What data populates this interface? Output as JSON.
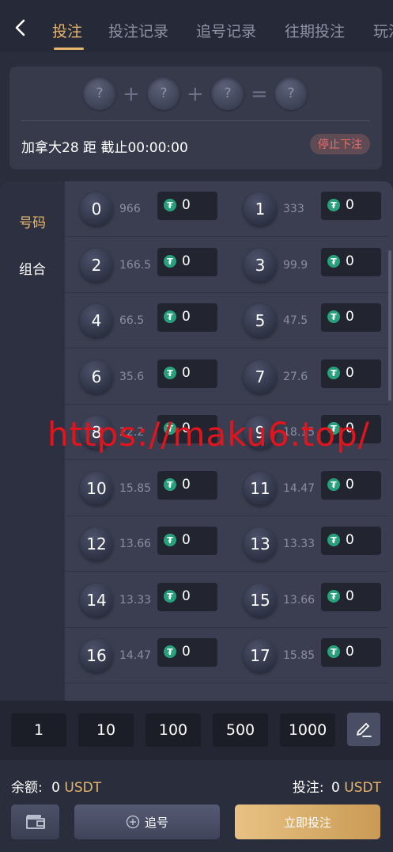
{
  "nav": {
    "tabs": [
      {
        "label": "投注"
      },
      {
        "label": "投注记录"
      },
      {
        "label": "追号记录"
      },
      {
        "label": "往期投注"
      },
      {
        "label": "玩法"
      }
    ]
  },
  "result": {
    "balls": [
      "?",
      "?",
      "?",
      "?"
    ],
    "plus": "+",
    "equals": "=",
    "lottery_info": "加拿大28 距 截止00:00:00",
    "stop_label": "停止下注"
  },
  "sidebar": {
    "items": [
      {
        "label": "号码"
      },
      {
        "label": "组合"
      }
    ]
  },
  "numbers": [
    {
      "num": "0",
      "odds": "966",
      "bet": "0"
    },
    {
      "num": "1",
      "odds": "333",
      "bet": "0"
    },
    {
      "num": "2",
      "odds": "166.5",
      "bet": "0"
    },
    {
      "num": "3",
      "odds": "99.9",
      "bet": "0"
    },
    {
      "num": "4",
      "odds": "66.5",
      "bet": "0"
    },
    {
      "num": "5",
      "odds": "47.5",
      "bet": "0"
    },
    {
      "num": "6",
      "odds": "35.6",
      "bet": "0"
    },
    {
      "num": "7",
      "odds": "27.6",
      "bet": "0"
    },
    {
      "num": "8",
      "odds": "22.2",
      "bet": "0"
    },
    {
      "num": "9",
      "odds": "18.15",
      "bet": "0"
    },
    {
      "num": "10",
      "odds": "15.85",
      "bet": "0"
    },
    {
      "num": "11",
      "odds": "14.47",
      "bet": "0"
    },
    {
      "num": "12",
      "odds": "13.66",
      "bet": "0"
    },
    {
      "num": "13",
      "odds": "13.33",
      "bet": "0"
    },
    {
      "num": "14",
      "odds": "13.33",
      "bet": "0"
    },
    {
      "num": "15",
      "odds": "13.66",
      "bet": "0"
    },
    {
      "num": "16",
      "odds": "14.47",
      "bet": "0"
    },
    {
      "num": "17",
      "odds": "15.85",
      "bet": "0"
    }
  ],
  "coin_icon": "tether-icon",
  "watermark": "https://maku6.top/",
  "chips": [
    "1",
    "10",
    "100",
    "500",
    "1000"
  ],
  "footer": {
    "balance_label": "余额:",
    "balance_value": "0",
    "balance_unit": "USDT",
    "bet_label": "投注:",
    "bet_value": "0",
    "bet_unit": "USDT",
    "follow_label": "追号",
    "submit_label": "立即投注"
  },
  "colors": {
    "accent": "#e6b66e",
    "stop": "#e8706f",
    "tether": "#26a17b",
    "watermark": "#e3141b"
  }
}
